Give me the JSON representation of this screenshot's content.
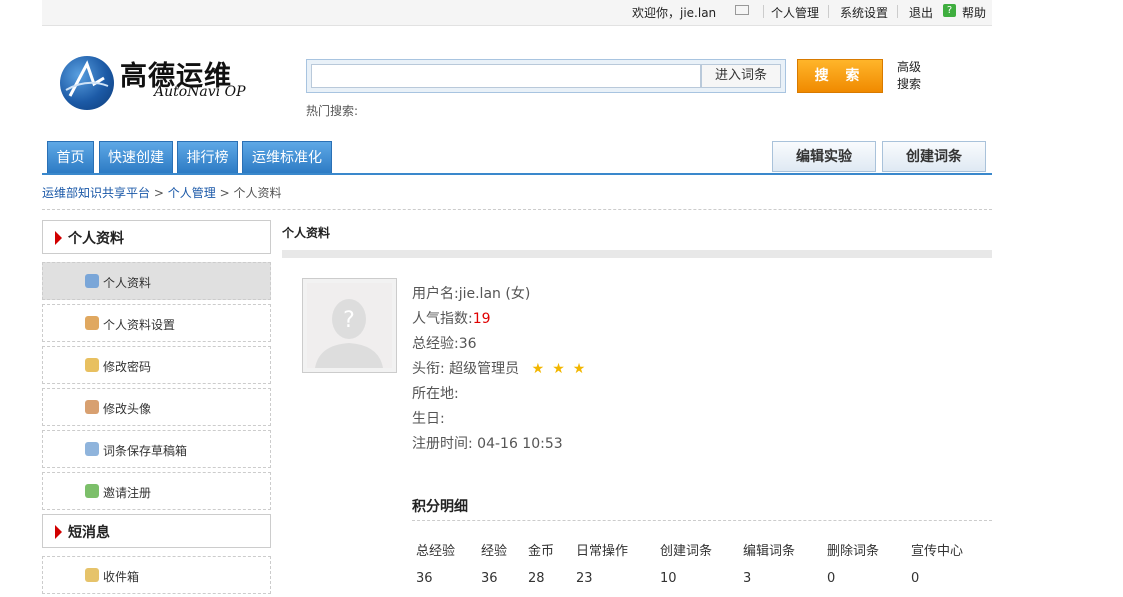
{
  "topbar": {
    "welcome": "欢迎你，jie.lan",
    "mail_icon": "envelope-icon",
    "links": [
      "个人管理",
      "系统设置",
      "退出",
      "帮助"
    ],
    "help_icon": "question-icon"
  },
  "logo": {
    "title": "高德运维",
    "subtitle": "AutoNavi OP"
  },
  "search": {
    "input_value": "",
    "enter_label": "进入词条",
    "button_label": "搜 索",
    "advanced_label": "高级搜索",
    "hot_label": "热门搜索:"
  },
  "nav": {
    "tabs": [
      "首页",
      "快速创建",
      "排行榜",
      "运维标准化"
    ],
    "right_tabs": [
      "编辑实验",
      "创建词条"
    ]
  },
  "breadcrumb": [
    "运维部知识共享平台",
    "个人管理",
    "个人资料"
  ],
  "sidebar": {
    "sections": [
      {
        "title": "个人资料",
        "items": [
          "个人资料",
          "个人资料设置",
          "修改密码",
          "修改头像",
          "词条保存草稿箱",
          "邀请注册"
        ]
      },
      {
        "title": "短消息",
        "items": [
          "收件箱"
        ]
      }
    ]
  },
  "profile": {
    "section_title": "个人资料",
    "username_label": "用户名:",
    "username": "jie.lan (女)",
    "popularity_label": "人气指数:",
    "popularity": "19",
    "experience": "总经验:36",
    "title_label": "头衔: ",
    "title": "超级管理员",
    "location": "所在地:",
    "birthday": "生日:",
    "register": "注册时间: 04-16 10:53"
  },
  "score": {
    "title": "积分明细",
    "headers": [
      "总经验",
      "经验",
      "金币",
      "日常操作",
      "创建词条",
      "编辑词条",
      "删除词条",
      "宣传中心"
    ],
    "values": [
      "36",
      "36",
      "28",
      "23",
      "10",
      "3",
      "0",
      "0"
    ]
  },
  "colors": {
    "accent": "#2d7bc4",
    "search_button": "#f5a000",
    "highlight": "#e00000"
  }
}
